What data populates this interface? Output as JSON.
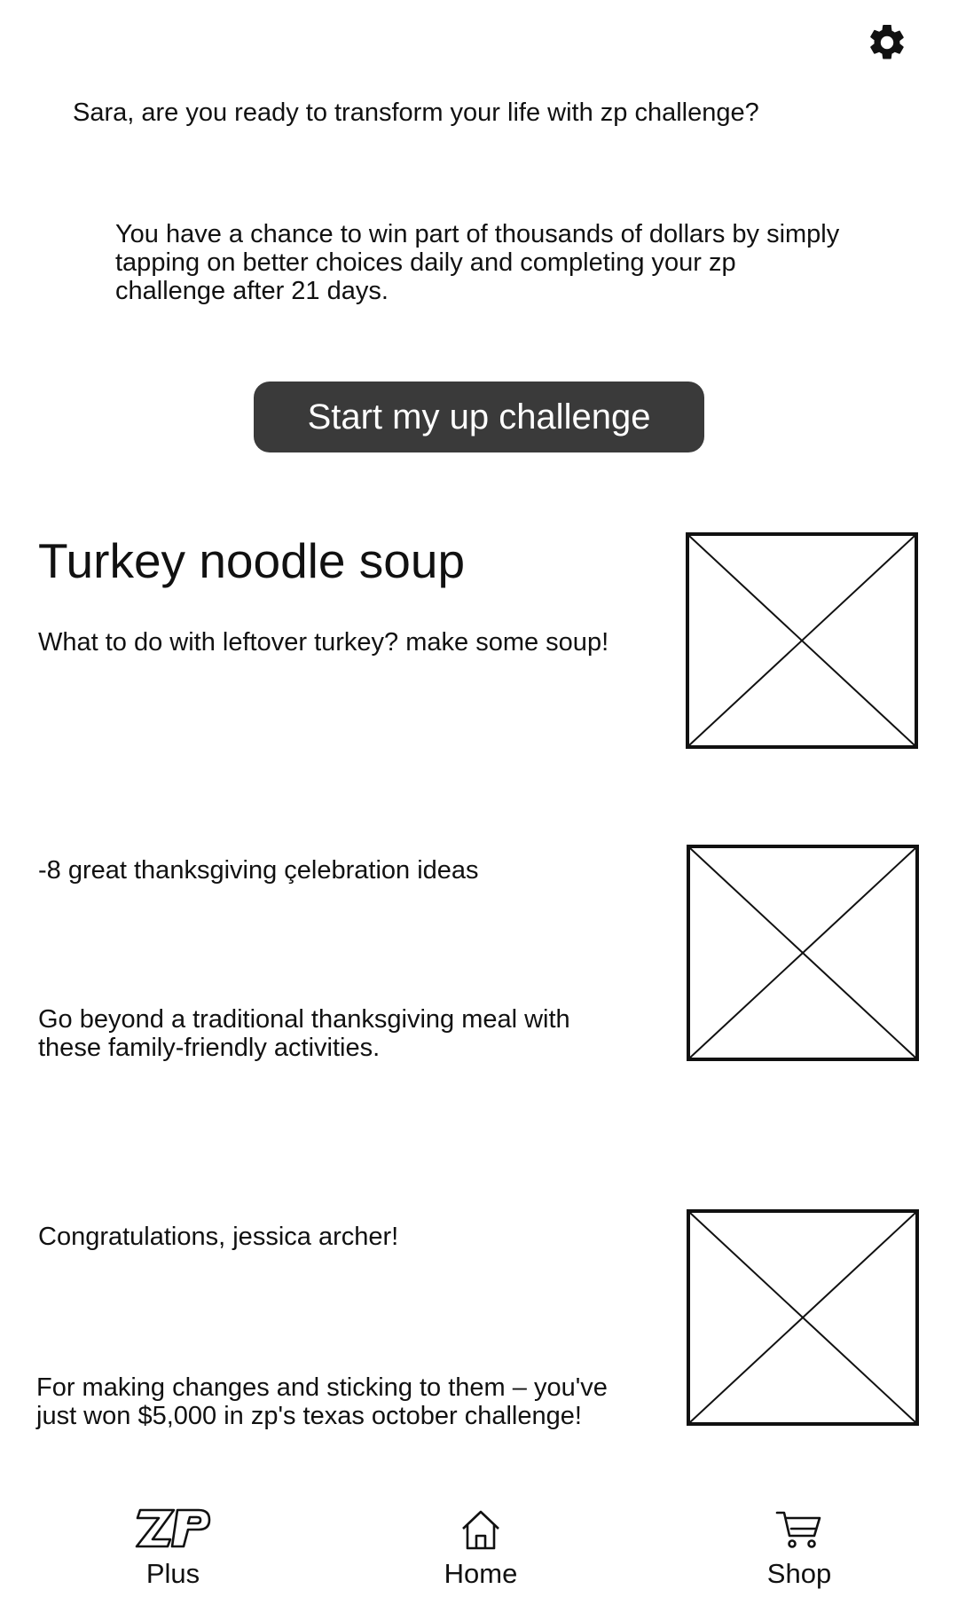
{
  "header": {
    "settings_icon": "gear-icon",
    "greeting": "Sara, are you ready to transform your life with zp challenge?",
    "intro": "You have a chance to win part of thousands of dollars by simply tapping on better choices daily and completing your zp challenge after 21 days.",
    "start_button_label": "Start my up challenge"
  },
  "feed": {
    "item1": {
      "title": "Turkey noodle soup",
      "text": "What to do with leftover turkey? make some soup!",
      "image_icon": "image-placeholder-icon"
    },
    "item2": {
      "title": "-8 great thanksgiving çelebration ideas",
      "text": "Go beyond a traditional thanksgiving meal with these family-friendly activities.",
      "image_icon": "image-placeholder-icon"
    },
    "item3": {
      "title": "Congratulations, jessica archer!",
      "text": "For making changes and sticking to them – you've just won $5,000 in zp's texas october challenge!",
      "image_icon": "image-placeholder-icon"
    }
  },
  "nav": {
    "plus": {
      "label": "Plus",
      "icon": "zp-logo-icon"
    },
    "home": {
      "label": "Home",
      "icon": "home-icon"
    },
    "shop": {
      "label": "Shop",
      "icon": "cart-icon"
    }
  }
}
